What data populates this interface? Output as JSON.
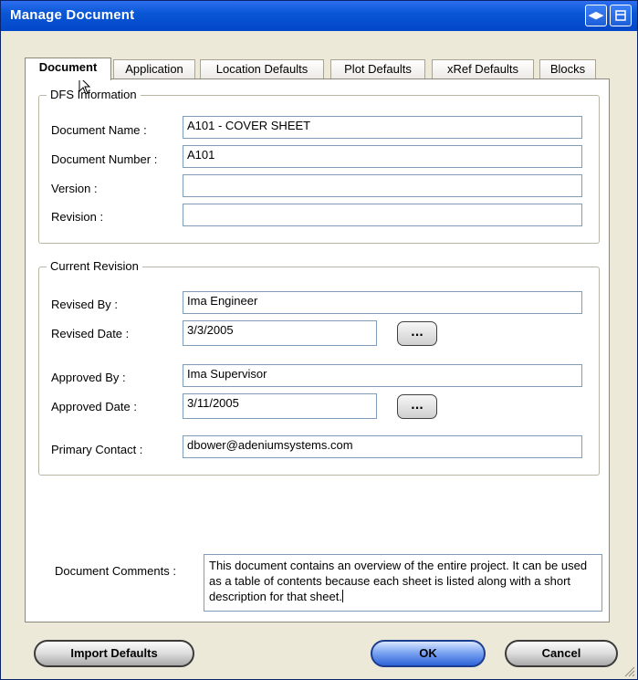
{
  "window": {
    "title": "Manage Document"
  },
  "tabs": [
    "Document",
    "Application",
    "Location Defaults",
    "Plot Defaults",
    "xRef Defaults",
    "Blocks"
  ],
  "dfs": {
    "legend": "DFS Information",
    "name_label": "Document Name :",
    "name_value": "A101 - COVER SHEET",
    "number_label": "Document Number :",
    "number_value": "A101",
    "version_label": "Version :",
    "version_value": "",
    "revision_label": "Revision :",
    "revision_value": ""
  },
  "revision": {
    "legend": "Current Revision",
    "revised_by_label": "Revised By :",
    "revised_by_value": "Ima Engineer",
    "revised_date_label": "Revised Date :",
    "revised_date_value": "3/3/2005",
    "approved_by_label": "Approved By :",
    "approved_by_value": "Ima Supervisor",
    "approved_date_label": "Approved Date :",
    "approved_date_value": "3/11/2005",
    "contact_label": "Primary Contact :",
    "contact_value": "dbower@adeniumsystems.com",
    "ellipsis": "..."
  },
  "comments": {
    "label": "Document Comments :",
    "value": "This document contains an overview of the entire project.  It can be used as a table of contents because each sheet is listed along with a short description for that sheet."
  },
  "buttons": {
    "import": "Import Defaults",
    "ok": "OK",
    "cancel": "Cancel"
  },
  "icons": {
    "titlebar_left": "restore-arrows-icon",
    "titlebar_right": "minimize-window-icon",
    "cursor": "mouse-pointer-icon",
    "grip": "resize-grip-icon"
  }
}
